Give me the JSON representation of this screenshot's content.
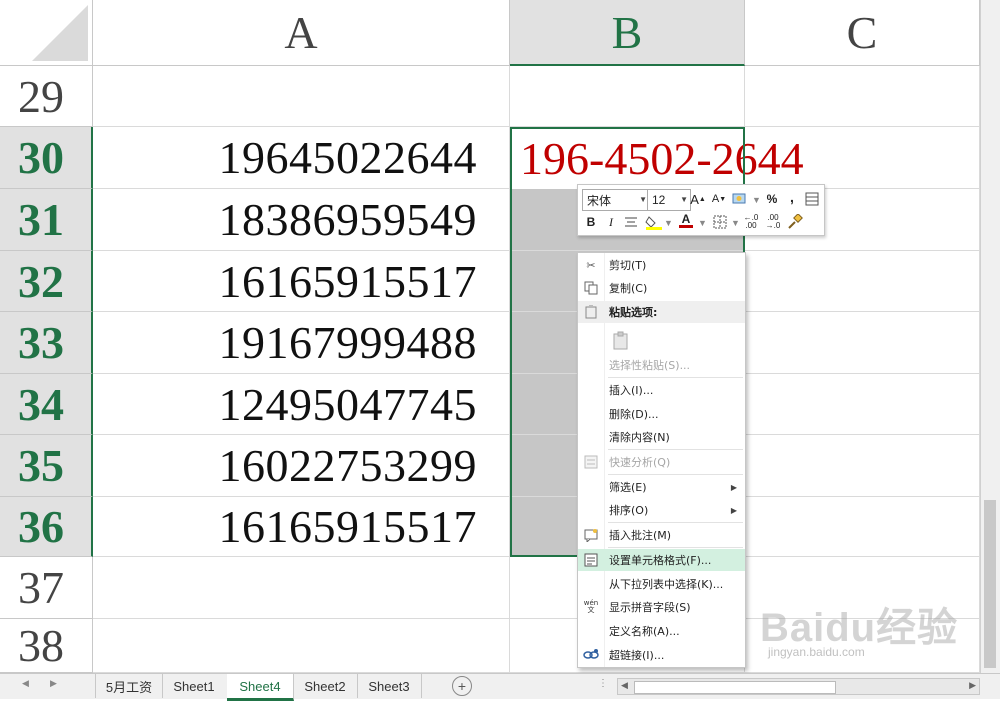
{
  "columns": [
    "A",
    "B",
    "C"
  ],
  "rows": [
    {
      "num": "29",
      "a": "",
      "b": ""
    },
    {
      "num": "30",
      "a": "19645022644",
      "b": "196-4502-2644"
    },
    {
      "num": "31",
      "a": "18386959549",
      "b": ""
    },
    {
      "num": "32",
      "a": "16165915517",
      "b": ""
    },
    {
      "num": "33",
      "a": "19167999488",
      "b": ""
    },
    {
      "num": "34",
      "a": "12495047745",
      "b": ""
    },
    {
      "num": "35",
      "a": "16022753299",
      "b": ""
    },
    {
      "num": "36",
      "a": "16165915517",
      "b": ""
    },
    {
      "num": "37",
      "a": "",
      "b": ""
    },
    {
      "num": "38",
      "a": "",
      "b": ""
    }
  ],
  "colors": {
    "accent": "#217346",
    "cell_text_red": "#c00000",
    "selection": "#c6c6c6"
  },
  "mini_toolbar": {
    "font_name": "宋体",
    "font_size": "12",
    "grow_label": "A",
    "shrink_label": "A",
    "percent": "%",
    "comma": ",",
    "bold": "B",
    "italic": "I",
    "font_color": "A",
    "dec_more": "←.0 .00",
    "dec_less": ".00 →.0"
  },
  "context_menu": {
    "cut": "剪切(T)",
    "copy": "复制(C)",
    "paste_options": "粘贴选项:",
    "paste_special": "选择性粘贴(S)...",
    "insert": "插入(I)...",
    "delete": "删除(D)...",
    "clear": "清除内容(N)",
    "quick_analysis": "快速分析(Q)",
    "filter": "筛选(E)",
    "sort": "排序(O)",
    "insert_comment": "插入批注(M)",
    "format_cells": "设置单元格格式(F)...",
    "pick_from_list": "从下拉列表中选择(K)...",
    "show_phonetic": "显示拼音字段(S)",
    "define_name": "定义名称(A)...",
    "hyperlink": "超链接(I)...",
    "phonetic_icon": "wén 文"
  },
  "tabs": [
    "5月工资",
    "Sheet1",
    "Sheet4",
    "Sheet2",
    "Sheet3"
  ],
  "active_tab": "Sheet4",
  "add_sheet": "+",
  "watermark": {
    "logo": "Baidu经验",
    "url": "jingyan.baidu.com"
  }
}
